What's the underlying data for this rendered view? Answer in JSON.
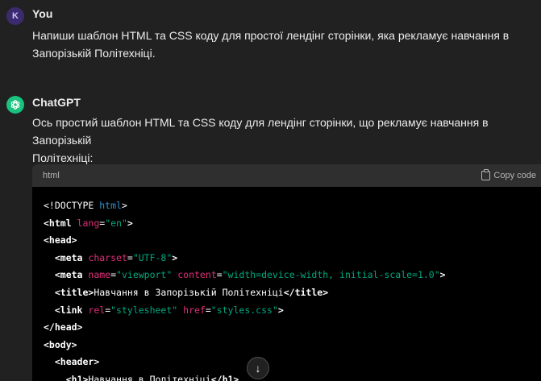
{
  "user": {
    "avatar_letter": "K",
    "name": "You",
    "message": "Напиши шаблон HTML та CSS коду для простої лендінг сторінки, яка рекламує навчання в\nЗапорізькій Політехніці."
  },
  "assistant": {
    "avatar_icon": "openai-logo-icon",
    "name": "ChatGPT",
    "message": "Ось простий шаблон HTML та CSS коду для лендінг сторінки, що рекламує навчання в Запорізькій\nПолітехніці:"
  },
  "code_block": {
    "language": "html",
    "copy_label": "Copy code",
    "lines": [
      {
        "indent": "",
        "parts": [
          {
            "t": "<!DOCTYPE ",
            "c": "txt"
          },
          {
            "t": "html",
            "c": "kw"
          },
          {
            "t": ">",
            "c": "txt"
          }
        ]
      },
      {
        "indent": "",
        "parts": [
          {
            "t": "<html",
            "c": "tag"
          },
          {
            "t": " lang",
            "c": "attr"
          },
          {
            "t": "=",
            "c": "txt"
          },
          {
            "t": "\"en\"",
            "c": "str"
          },
          {
            "t": ">",
            "c": "tag"
          }
        ]
      },
      {
        "indent": "",
        "parts": [
          {
            "t": "<head>",
            "c": "tag"
          }
        ]
      },
      {
        "indent": "  ",
        "parts": [
          {
            "t": "<meta",
            "c": "tag"
          },
          {
            "t": " charset",
            "c": "attr"
          },
          {
            "t": "=",
            "c": "txt"
          },
          {
            "t": "\"UTF-8\"",
            "c": "str"
          },
          {
            "t": ">",
            "c": "tag"
          }
        ]
      },
      {
        "indent": "  ",
        "parts": [
          {
            "t": "<meta",
            "c": "tag"
          },
          {
            "t": " name",
            "c": "attr"
          },
          {
            "t": "=",
            "c": "txt"
          },
          {
            "t": "\"viewport\"",
            "c": "str"
          },
          {
            "t": " content",
            "c": "attr"
          },
          {
            "t": "=",
            "c": "txt"
          },
          {
            "t": "\"width=device-width, initial-scale=1.0\"",
            "c": "str"
          },
          {
            "t": ">",
            "c": "tag"
          }
        ]
      },
      {
        "indent": "  ",
        "parts": [
          {
            "t": "<title>",
            "c": "tag"
          },
          {
            "t": "Навчання в Запорізькій Політехніці",
            "c": "txt"
          },
          {
            "t": "</title>",
            "c": "tag"
          }
        ]
      },
      {
        "indent": "  ",
        "parts": [
          {
            "t": "<link",
            "c": "tag"
          },
          {
            "t": " rel",
            "c": "attr"
          },
          {
            "t": "=",
            "c": "txt"
          },
          {
            "t": "\"stylesheet\"",
            "c": "str"
          },
          {
            "t": " href",
            "c": "attr"
          },
          {
            "t": "=",
            "c": "txt"
          },
          {
            "t": "\"styles.css\"",
            "c": "str"
          },
          {
            "t": ">",
            "c": "tag"
          }
        ]
      },
      {
        "indent": "",
        "parts": [
          {
            "t": "</head>",
            "c": "tag"
          }
        ]
      },
      {
        "indent": "",
        "parts": [
          {
            "t": "<body>",
            "c": "tag"
          }
        ]
      },
      {
        "indent": "  ",
        "parts": [
          {
            "t": "<header>",
            "c": "tag"
          }
        ]
      },
      {
        "indent": "    ",
        "parts": [
          {
            "t": "<h1>",
            "c": "tag"
          },
          {
            "t": "Навчання в Політехніці",
            "c": "txt"
          },
          {
            "t": "</h1>",
            "c": "tag"
          }
        ]
      }
    ]
  },
  "scroll_button": {
    "icon": "arrow-down-icon",
    "glyph": "↓"
  },
  "colors": {
    "background": "#212121",
    "code_bg": "#000000",
    "code_header_bg": "#2f2f2f",
    "keyword": "#2e95d3",
    "attribute": "#df3079",
    "string": "#00a67d",
    "user_avatar": "#3b2b6e",
    "gpt_avatar": "#19c37d"
  }
}
